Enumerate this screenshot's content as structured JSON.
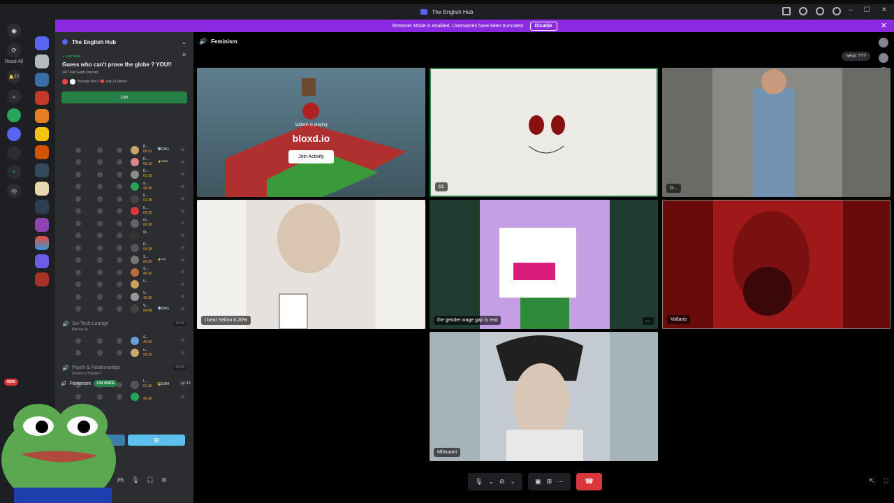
{
  "window": {
    "title": "The English Hub"
  },
  "banner": {
    "message": "Streamer Mode is enabled. Usernames have been truncated.",
    "disable_label": "Disable",
    "color": "#8a2be2"
  },
  "rail": {
    "read_all_label": "Read All",
    "new_badge": "NEW",
    "notify_count": "22"
  },
  "server": {
    "name": "The English Hub",
    "live": {
      "label": "● Live Now",
      "title": "Guess who can't prove the globe ? YOU!!",
      "subtitle": "24/7 Flat Earth Discord",
      "people": "Youtube Bot 2 🔴 and 21 others",
      "join_label": "Join"
    }
  },
  "voice_users": [
    {
      "name": "B...",
      "time": "00:21",
      "tag": "💎ENG",
      "color": "#c9a76b"
    },
    {
      "name": "D...",
      "time": "00:13",
      "tag": "⚡ᴴᴿᴱᵂ",
      "color": "#d98787"
    },
    {
      "name": "D...",
      "time": "01:39",
      "tag": "",
      "color": "#8c8c8c"
    },
    {
      "name": "d...",
      "time": "49:30",
      "tag": "",
      "color": "#23a55a"
    },
    {
      "name": "E...",
      "time": "01:28",
      "tag": "",
      "color": "#444"
    },
    {
      "name": "E...",
      "time": "00:25",
      "tag": "",
      "color": "#da373c"
    },
    {
      "name": "m...",
      "time": "00:36",
      "tag": "",
      "color": "#666"
    },
    {
      "name": "M...",
      "time": "",
      "tag": "",
      "color": "#333"
    },
    {
      "name": "R...",
      "time": "00:38",
      "tag": "",
      "color": "#555"
    },
    {
      "name": "S...",
      "time": "00:30",
      "tag": "⚡ʰʷᵉ",
      "color": "#777"
    },
    {
      "name": "S...",
      "time": "49:30",
      "tag": "",
      "color": "#b86b3c"
    },
    {
      "name": "U...",
      "time": "",
      "tag": "",
      "color": "#c8a060"
    },
    {
      "name": "V...",
      "time": "49:30",
      "tag": "",
      "color": "#999"
    },
    {
      "name": "V...",
      "time": "04:58",
      "tag": "💎ENG",
      "color": "#444"
    }
  ],
  "channels": [
    {
      "name": "Sci-Tech Lounge",
      "status": "Blazing 8s",
      "count": "02 99"
    },
    {
      "name": "Psych & Relationships",
      "status": "Divorce a cheater?",
      "count": "02 99"
    }
  ],
  "scitech_users": [
    {
      "name": "S...",
      "time": "49:30",
      "tag": "",
      "color": "#6aa0d8"
    },
    {
      "name": "u...",
      "time": "56:32",
      "tag": "",
      "color": "#c9a76b"
    }
  ],
  "psych_users": [
    {
      "name": "L...",
      "time": "01:36",
      "tag": "🔱1984",
      "color": "#555"
    },
    {
      "name": "",
      "time": "49:30",
      "tag": "",
      "color": "#23a55a"
    }
  ],
  "current_channel": {
    "name": "Feminism",
    "in_voice": "3 IN VOICE",
    "time": "24:44"
  },
  "main": {
    "channel_name": "Feminism",
    "bubble": "neon ???",
    "tiles": [
      {
        "label": "",
        "activity_caption": "Voltaris is playing",
        "activity_name": "bloxd.io",
        "activity_btn": "Join Activity"
      },
      {
        "label": "b1"
      },
      {
        "label": "D..."
      },
      {
        "label": "I beat Sekiro 6.20%"
      },
      {
        "label": "the gender wage gap is real"
      },
      {
        "label": "Voltaris"
      },
      {
        "label": "Mitsuomi"
      }
    ]
  }
}
